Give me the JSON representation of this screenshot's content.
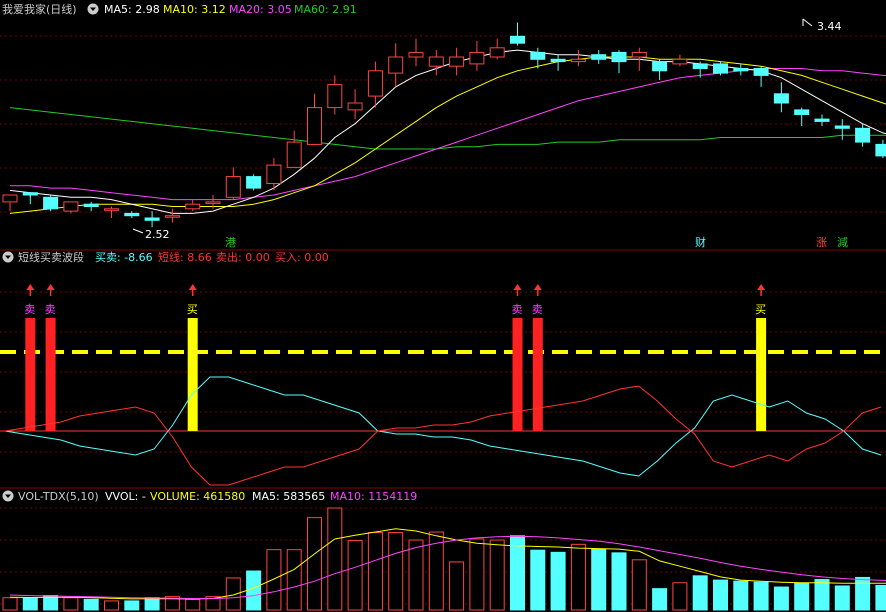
{
  "colors": {
    "up": "#ff4444",
    "down": "#54ffff",
    "ma5": "#ffffff",
    "ma10": "#ffff00",
    "ma20": "#ff44ff",
    "ma60": "#22cc22",
    "grid": "#7a0000",
    "separator": "#8a0000",
    "buy": "#ffff00",
    "sell": "#ff2222",
    "dash": "#ffff00"
  },
  "main": {
    "title": "我爱我家(日线)",
    "legend": [
      {
        "label": "MA5: 2.98",
        "color": "#ffffff"
      },
      {
        "label": "MA10: 3.12",
        "color": "#ffff00"
      },
      {
        "label": "MA20: 3.05",
        "color": "#ff44ff"
      },
      {
        "label": "MA60: 2.91",
        "color": "#22cc22"
      }
    ],
    "high_label": "3.44",
    "low_label": "2.52",
    "markers": [
      {
        "text": "港",
        "color": "#22cc22"
      },
      {
        "text": "财",
        "color": "#54ffff"
      },
      {
        "text": "涨",
        "color": "#ff4444"
      },
      {
        "text": "減",
        "color": "#22cc22"
      }
    ],
    "candles": [
      [
        2.67,
        2.7,
        2.63,
        2.69
      ],
      [
        2.71,
        2.7,
        2.66,
        2.69
      ],
      [
        2.69,
        2.64,
        2.63,
        2.7
      ],
      [
        2.63,
        2.67,
        2.62,
        2.67
      ],
      [
        2.66,
        2.65,
        2.63,
        2.67
      ],
      [
        2.64,
        2.64,
        2.6,
        2.65
      ],
      [
        2.62,
        2.61,
        2.6,
        2.63
      ],
      [
        2.6,
        2.59,
        2.56,
        2.63
      ],
      [
        2.61,
        2.61,
        2.58,
        2.64
      ],
      [
        2.64,
        2.66,
        2.63,
        2.68
      ],
      [
        2.67,
        2.67,
        2.64,
        2.7
      ],
      [
        2.69,
        2.78,
        2.68,
        2.82
      ],
      [
        2.78,
        2.73,
        2.72,
        2.79
      ],
      [
        2.75,
        2.83,
        2.72,
        2.86
      ],
      [
        2.82,
        2.93,
        2.82,
        2.98
      ],
      [
        2.92,
        3.08,
        2.92,
        3.14
      ],
      [
        3.08,
        3.18,
        3.05,
        3.22
      ],
      [
        3.07,
        3.1,
        3.03,
        3.16
      ],
      [
        3.13,
        3.24,
        3.08,
        3.28
      ],
      [
        3.23,
        3.3,
        3.17,
        3.36
      ],
      [
        3.3,
        3.32,
        3.26,
        3.38
      ],
      [
        3.26,
        3.3,
        3.22,
        3.33
      ],
      [
        3.26,
        3.3,
        3.22,
        3.34
      ],
      [
        3.27,
        3.32,
        3.24,
        3.37
      ],
      [
        3.3,
        3.34,
        3.29,
        3.38
      ],
      [
        3.39,
        3.36,
        3.35,
        3.45
      ],
      [
        3.32,
        3.29,
        3.25,
        3.34
      ],
      [
        3.29,
        3.28,
        3.24,
        3.31
      ],
      [
        3.28,
        3.29,
        3.26,
        3.33
      ],
      [
        3.31,
        3.29,
        3.27,
        3.33
      ],
      [
        3.32,
        3.28,
        3.23,
        3.33
      ],
      [
        3.3,
        3.32,
        3.24,
        3.34
      ],
      [
        3.28,
        3.24,
        3.2,
        3.29
      ],
      [
        3.27,
        3.29,
        3.26,
        3.31
      ],
      [
        3.27,
        3.25,
        3.21,
        3.28
      ],
      [
        3.27,
        3.23,
        3.22,
        3.28
      ],
      [
        3.25,
        3.24,
        3.22,
        3.27
      ],
      [
        3.25,
        3.22,
        3.17,
        3.26
      ],
      [
        3.14,
        3.1,
        3.06,
        3.19
      ],
      [
        3.07,
        3.05,
        3.0,
        3.08
      ],
      [
        3.03,
        3.02,
        3.0,
        3.05
      ],
      [
        3.0,
        2.99,
        2.94,
        3.03
      ],
      [
        2.99,
        2.93,
        2.91,
        3.01
      ],
      [
        2.92,
        2.87,
        2.86,
        2.94
      ],
      [
        2.86,
        2.96,
        2.85,
        3.01
      ],
      [
        2.96,
        3.02,
        2.96,
        3.08
      ],
      [
        3.02,
        3.13,
        3.02,
        3.21
      ],
      [
        3.13,
        3.24,
        3.13,
        3.34
      ],
      [
        3.24,
        3.34,
        3.23,
        3.4
      ],
      [
        3.28,
        3.3,
        3.25,
        3.36
      ],
      [
        3.29,
        3.32,
        3.26,
        3.36
      ],
      [
        3.35,
        3.36,
        3.34,
        3.44
      ],
      [
        3.33,
        3.28,
        3.22,
        3.39
      ],
      [
        3.36,
        3.29,
        3.24,
        3.36
      ],
      [
        3.32,
        3.32,
        3.27,
        3.37
      ],
      [
        3.32,
        3.31,
        3.27,
        3.37
      ]
    ],
    "ma5": [
      2.72,
      2.71,
      2.7,
      2.69,
      2.69,
      2.68,
      2.66,
      2.64,
      2.62,
      2.62,
      2.63,
      2.66,
      2.69,
      2.73,
      2.79,
      2.86,
      2.95,
      3.01,
      3.09,
      3.17,
      3.22,
      3.25,
      3.28,
      3.3,
      3.32,
      3.33,
      3.32,
      3.31,
      3.31,
      3.3,
      3.29,
      3.29,
      3.28,
      3.28,
      3.27,
      3.26,
      3.25,
      3.24,
      3.21,
      3.16,
      3.11,
      3.06,
      3.01,
      2.97,
      2.95,
      2.95,
      2.98,
      3.04,
      3.13,
      3.2,
      3.26,
      3.31,
      3.32,
      3.31,
      3.31,
      3.3
    ],
    "ma10": [
      2.62,
      2.63,
      2.64,
      2.65,
      2.66,
      2.66,
      2.66,
      2.66,
      2.65,
      2.65,
      2.65,
      2.65,
      2.66,
      2.68,
      2.71,
      2.74,
      2.79,
      2.84,
      2.9,
      2.96,
      3.02,
      3.08,
      3.13,
      3.17,
      3.21,
      3.24,
      3.26,
      3.28,
      3.29,
      3.3,
      3.3,
      3.3,
      3.29,
      3.29,
      3.29,
      3.28,
      3.27,
      3.26,
      3.24,
      3.22,
      3.19,
      3.16,
      3.13,
      3.1,
      3.07,
      3.04,
      3.02,
      3.01,
      3.02,
      3.05,
      3.08,
      3.12,
      3.16,
      3.2,
      3.23,
      3.26
    ],
    "ma20": [
      2.74,
      2.74,
      2.73,
      2.73,
      2.72,
      2.71,
      2.7,
      2.69,
      2.68,
      2.68,
      2.68,
      2.68,
      2.69,
      2.7,
      2.72,
      2.74,
      2.76,
      2.78,
      2.81,
      2.84,
      2.87,
      2.9,
      2.93,
      2.96,
      2.99,
      3.02,
      3.05,
      3.08,
      3.11,
      3.13,
      3.15,
      3.17,
      3.19,
      3.21,
      3.22,
      3.23,
      3.24,
      3.25,
      3.25,
      3.25,
      3.24,
      3.24,
      3.23,
      3.22,
      3.22,
      3.21,
      3.21,
      3.21,
      3.21,
      3.22,
      3.22,
      3.23,
      3.23,
      3.24,
      3.24,
      3.24
    ],
    "ma60": [
      3.08,
      3.07,
      3.06,
      3.05,
      3.04,
      3.03,
      3.02,
      3.01,
      3.0,
      2.99,
      2.98,
      2.97,
      2.96,
      2.95,
      2.94,
      2.93,
      2.92,
      2.91,
      2.9,
      2.9,
      2.9,
      2.9,
      2.91,
      2.91,
      2.92,
      2.92,
      2.92,
      2.93,
      2.93,
      2.93,
      2.94,
      2.94,
      2.94,
      2.94,
      2.94,
      2.95,
      2.95,
      2.95,
      2.95,
      2.95,
      2.95,
      2.96,
      2.96,
      2.96,
      2.96,
      2.97,
      2.97,
      2.98,
      2.99,
      3.0,
      3.01,
      3.02,
      3.03,
      3.04,
      3.05,
      3.06
    ]
  },
  "indicator": {
    "name": "短线买卖波段",
    "legend": [
      {
        "label": "买卖: -8.66",
        "color": "#54ffff"
      },
      {
        "label": "短线: 8.66",
        "color": "#ff3333"
      },
      {
        "label": "卖出: 0.00",
        "color": "#ff3333"
      },
      {
        "label": "买入: 0.00",
        "color": "#ff3333"
      }
    ],
    "signals": [
      {
        "index": 1,
        "type": "sell",
        "label": "卖"
      },
      {
        "index": 2,
        "type": "sell",
        "label": "卖"
      },
      {
        "index": 9,
        "type": "buy",
        "label": "买"
      },
      {
        "index": 25,
        "type": "sell",
        "label": "卖"
      },
      {
        "index": 26,
        "type": "sell",
        "label": "卖"
      },
      {
        "index": 37,
        "type": "buy",
        "label": "买"
      }
    ],
    "buy_sell": [
      0,
      -1,
      -2,
      -3,
      -5,
      -6,
      -7,
      -8,
      -6,
      2,
      12,
      18,
      18,
      16,
      14,
      12,
      12,
      10,
      8,
      6,
      0,
      -1,
      -1,
      -2,
      -2,
      -3,
      -5,
      -6,
      -7,
      -8,
      -9,
      -10,
      -12,
      -14,
      -15,
      -10,
      -4,
      1,
      10,
      12,
      10,
      8,
      10,
      6,
      4,
      0,
      -6,
      -8
    ],
    "short": [
      0,
      1,
      2,
      3,
      5,
      6,
      7,
      8,
      6,
      -2,
      -12,
      -18,
      -18,
      -16,
      -14,
      -12,
      -12,
      -10,
      -8,
      -6,
      0,
      1,
      1,
      2,
      2,
      3,
      5,
      6,
      7,
      8,
      9,
      10,
      12,
      14,
      15,
      10,
      4,
      -1,
      -10,
      -12,
      -10,
      -8,
      -10,
      -6,
      -4,
      0,
      6,
      8
    ]
  },
  "volume": {
    "name": "VOL-TDX(5,10)",
    "legend": [
      {
        "label": "VVOL: -",
        "color": "#ffffff"
      },
      {
        "label": "VOLUME: 461580",
        "color": "#ffff00"
      },
      {
        "label": "MA5: 583565",
        "color": "#ffffff"
      },
      {
        "label": "MA10: 1154119",
        "color": "#ff44ff"
      }
    ],
    "values": [
      230000,
      230000,
      270000,
      230000,
      200000,
      170000,
      170000,
      230000,
      250000,
      200000,
      250000,
      600000,
      730000,
      1130000,
      1130000,
      1730000,
      1910000,
      1300000,
      1450000,
      1450000,
      1310000,
      1460000,
      900000,
      1330000,
      1310000,
      1390000,
      1120000,
      1080000,
      1230000,
      1140000,
      1070000,
      940000,
      400000,
      510000,
      640000,
      560000,
      540000,
      520000,
      430000,
      500000,
      570000,
      450000,
      610000,
      460000,
      500000,
      420000,
      620000,
      550000,
      1300000,
      1100000,
      950000,
      1150000,
      1700000,
      1410000,
      1130000,
      830000
    ],
    "ma5": [
      240000,
      235000,
      240000,
      238000,
      232000,
      220000,
      208000,
      210000,
      212000,
      206000,
      216000,
      280000,
      410000,
      580000,
      760000,
      1050000,
      1330000,
      1400000,
      1460000,
      1520000,
      1480000,
      1390000,
      1310000,
      1250000,
      1220000,
      1200000,
      1190000,
      1180000,
      1160000,
      1150000,
      1140000,
      1100000,
      920000,
      820000,
      720000,
      620000,
      560000,
      540000,
      520000,
      510000,
      510000,
      500000,
      500000,
      500000,
      510000,
      520000,
      560000,
      650000,
      760000,
      860000,
      980000,
      1100000,
      1160000,
      1200000,
      1260000,
      1300000
    ],
    "ma10": [
      280000,
      270000,
      262000,
      254000,
      248000,
      240000,
      230000,
      224000,
      220000,
      216000,
      214000,
      230000,
      270000,
      340000,
      430000,
      540000,
      680000,
      800000,
      930000,
      1060000,
      1170000,
      1250000,
      1310000,
      1350000,
      1370000,
      1380000,
      1370000,
      1350000,
      1320000,
      1290000,
      1240000,
      1180000,
      1110000,
      1040000,
      970000,
      890000,
      820000,
      760000,
      710000,
      660000,
      620000,
      590000,
      570000,
      555000,
      545000,
      535000,
      540000,
      560000,
      600000,
      650000,
      700000,
      760000,
      820000,
      880000,
      930000,
      970000
    ]
  }
}
